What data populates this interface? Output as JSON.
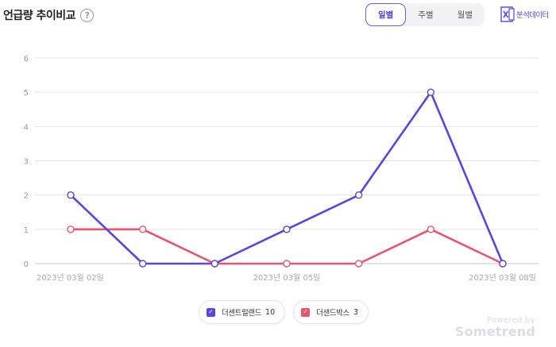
{
  "header": {
    "title": "언급량 추이비교",
    "help_symbol": "?",
    "tabs": [
      {
        "label": "일별",
        "active": true
      },
      {
        "label": "주별",
        "active": false
      },
      {
        "label": "월별",
        "active": false
      }
    ],
    "export_label": "분석데이터"
  },
  "colors": {
    "series_1": "#5b45db",
    "series_2": "#e6566f"
  },
  "chart_data": {
    "type": "line",
    "x": [
      "2023년 03월 02일",
      "2023년 03월 03일",
      "2023년 03월 04일",
      "2023년 03월 05일",
      "2023년 03월 06일",
      "2023년 03월 07일",
      "2023년 03월 08일"
    ],
    "x_tick_labels": [
      "2023년 03월 02일",
      "2023년 03월 05일",
      "2023년 03월 08일"
    ],
    "ylim": [
      0,
      6
    ],
    "yticks": [
      0,
      1,
      2,
      3,
      4,
      5,
      6
    ],
    "grid": true,
    "legend_position": "bottom-center",
    "series": [
      {
        "name": "더센트럴랜드",
        "total": "10",
        "values": [
          2,
          0,
          0,
          1,
          2,
          5,
          0
        ]
      },
      {
        "name": "더샌드박스",
        "total": "3",
        "values": [
          1,
          1,
          0,
          0,
          0,
          1,
          0
        ]
      }
    ]
  },
  "footer": {
    "powered_by": "Powered by",
    "brand": "Sometrend"
  }
}
